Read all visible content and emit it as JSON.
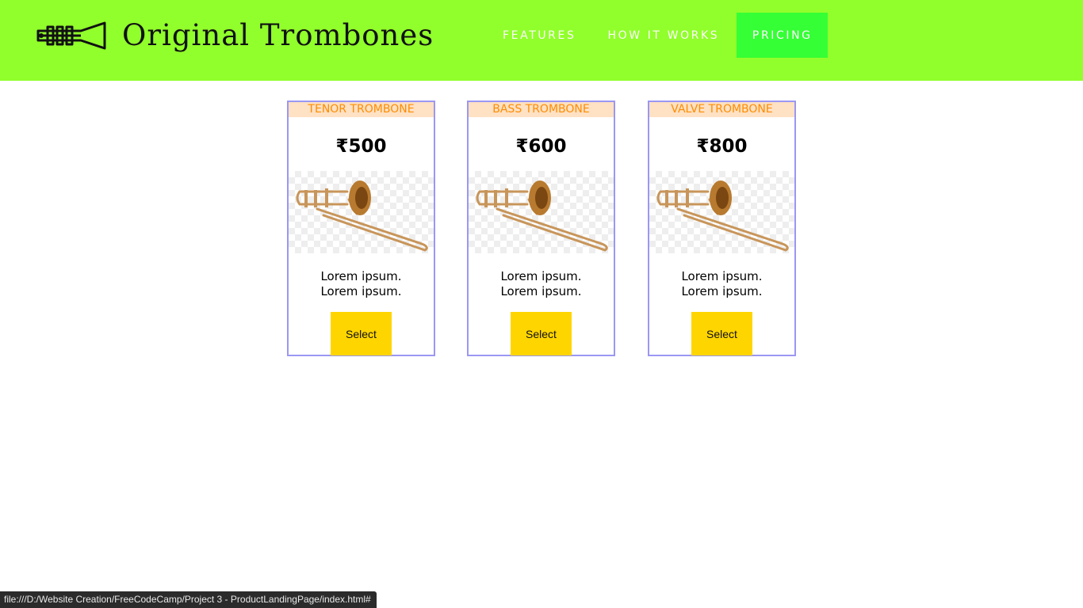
{
  "header": {
    "brand": "Original Trombones",
    "logo_icon": "trombone-icon",
    "background": "#91ff2b",
    "nav": [
      {
        "label": "FEATURES",
        "active": false
      },
      {
        "label": "HOW IT WORKS",
        "active": false
      },
      {
        "label": "PRICING",
        "active": true
      }
    ],
    "active_nav_color": "#35ff35"
  },
  "products": [
    {
      "title": "TENOR TROMBONE",
      "price": "₹500",
      "image_icon": "trombone-image",
      "desc_line1": "Lorem ipsum.",
      "desc_line2": "Lorem ipsum.",
      "button": "Select"
    },
    {
      "title": "BASS TROMBONE",
      "price": "₹600",
      "image_icon": "trombone-image",
      "desc_line1": "Lorem ipsum.",
      "desc_line2": "Lorem ipsum.",
      "button": "Select"
    },
    {
      "title": "VALVE TROMBONE",
      "price": "₹800",
      "image_icon": "trombone-image",
      "desc_line1": "Lorem ipsum.",
      "desc_line2": "Lorem ipsum.",
      "button": "Select"
    }
  ],
  "colors": {
    "card_border": "#9b97f3",
    "card_title_bg": "#ffe1c4",
    "card_title_text": "#ff8c00",
    "button_bg": "#ffd500"
  },
  "status_bar": {
    "url": "file:///D:/Website Creation/FreeCodeCamp/Project 3 - ProductLandingPage/index.html#"
  }
}
